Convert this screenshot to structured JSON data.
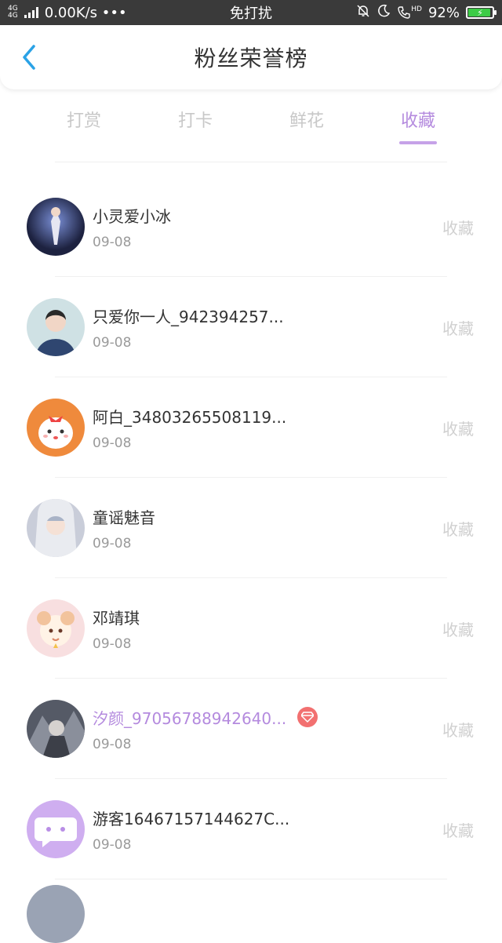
{
  "status_bar": {
    "network_top": "4G",
    "network_bottom": "4G",
    "speed": "0.00K/s •••",
    "center": "免打扰",
    "hd": "HD",
    "battery_percent": "92%",
    "battery_level": 0.92
  },
  "header": {
    "title": "粉丝荣誉榜"
  },
  "tabs": [
    {
      "label": "打赏",
      "active": false
    },
    {
      "label": "打卡",
      "active": false
    },
    {
      "label": "鲜花",
      "active": false
    },
    {
      "label": "收藏",
      "active": true
    }
  ],
  "list": [
    {
      "name": "小灵爱小冰",
      "date": "09-08",
      "action": "收藏",
      "vip": false
    },
    {
      "name": "只爱你一人_942394257...",
      "date": "09-08",
      "action": "收藏",
      "vip": false
    },
    {
      "name": "阿白_34803265508119...",
      "date": "09-08",
      "action": "收藏",
      "vip": false
    },
    {
      "name": "童谣魅音",
      "date": "09-08",
      "action": "收藏",
      "vip": false
    },
    {
      "name": "邓靖琪",
      "date": "09-08",
      "action": "收藏",
      "vip": false
    },
    {
      "name": "汐颜_97056788942640...",
      "date": "09-08",
      "action": "收藏",
      "vip": true
    },
    {
      "name": "游客16467157144627C...",
      "date": "09-08",
      "action": "收藏",
      "vip": false
    }
  ],
  "colors": {
    "accent": "#b48ade",
    "inactive_tab": "#c8c8c8",
    "status_bar_bg": "#3a3a3a",
    "vip_badge": "#f27070"
  }
}
